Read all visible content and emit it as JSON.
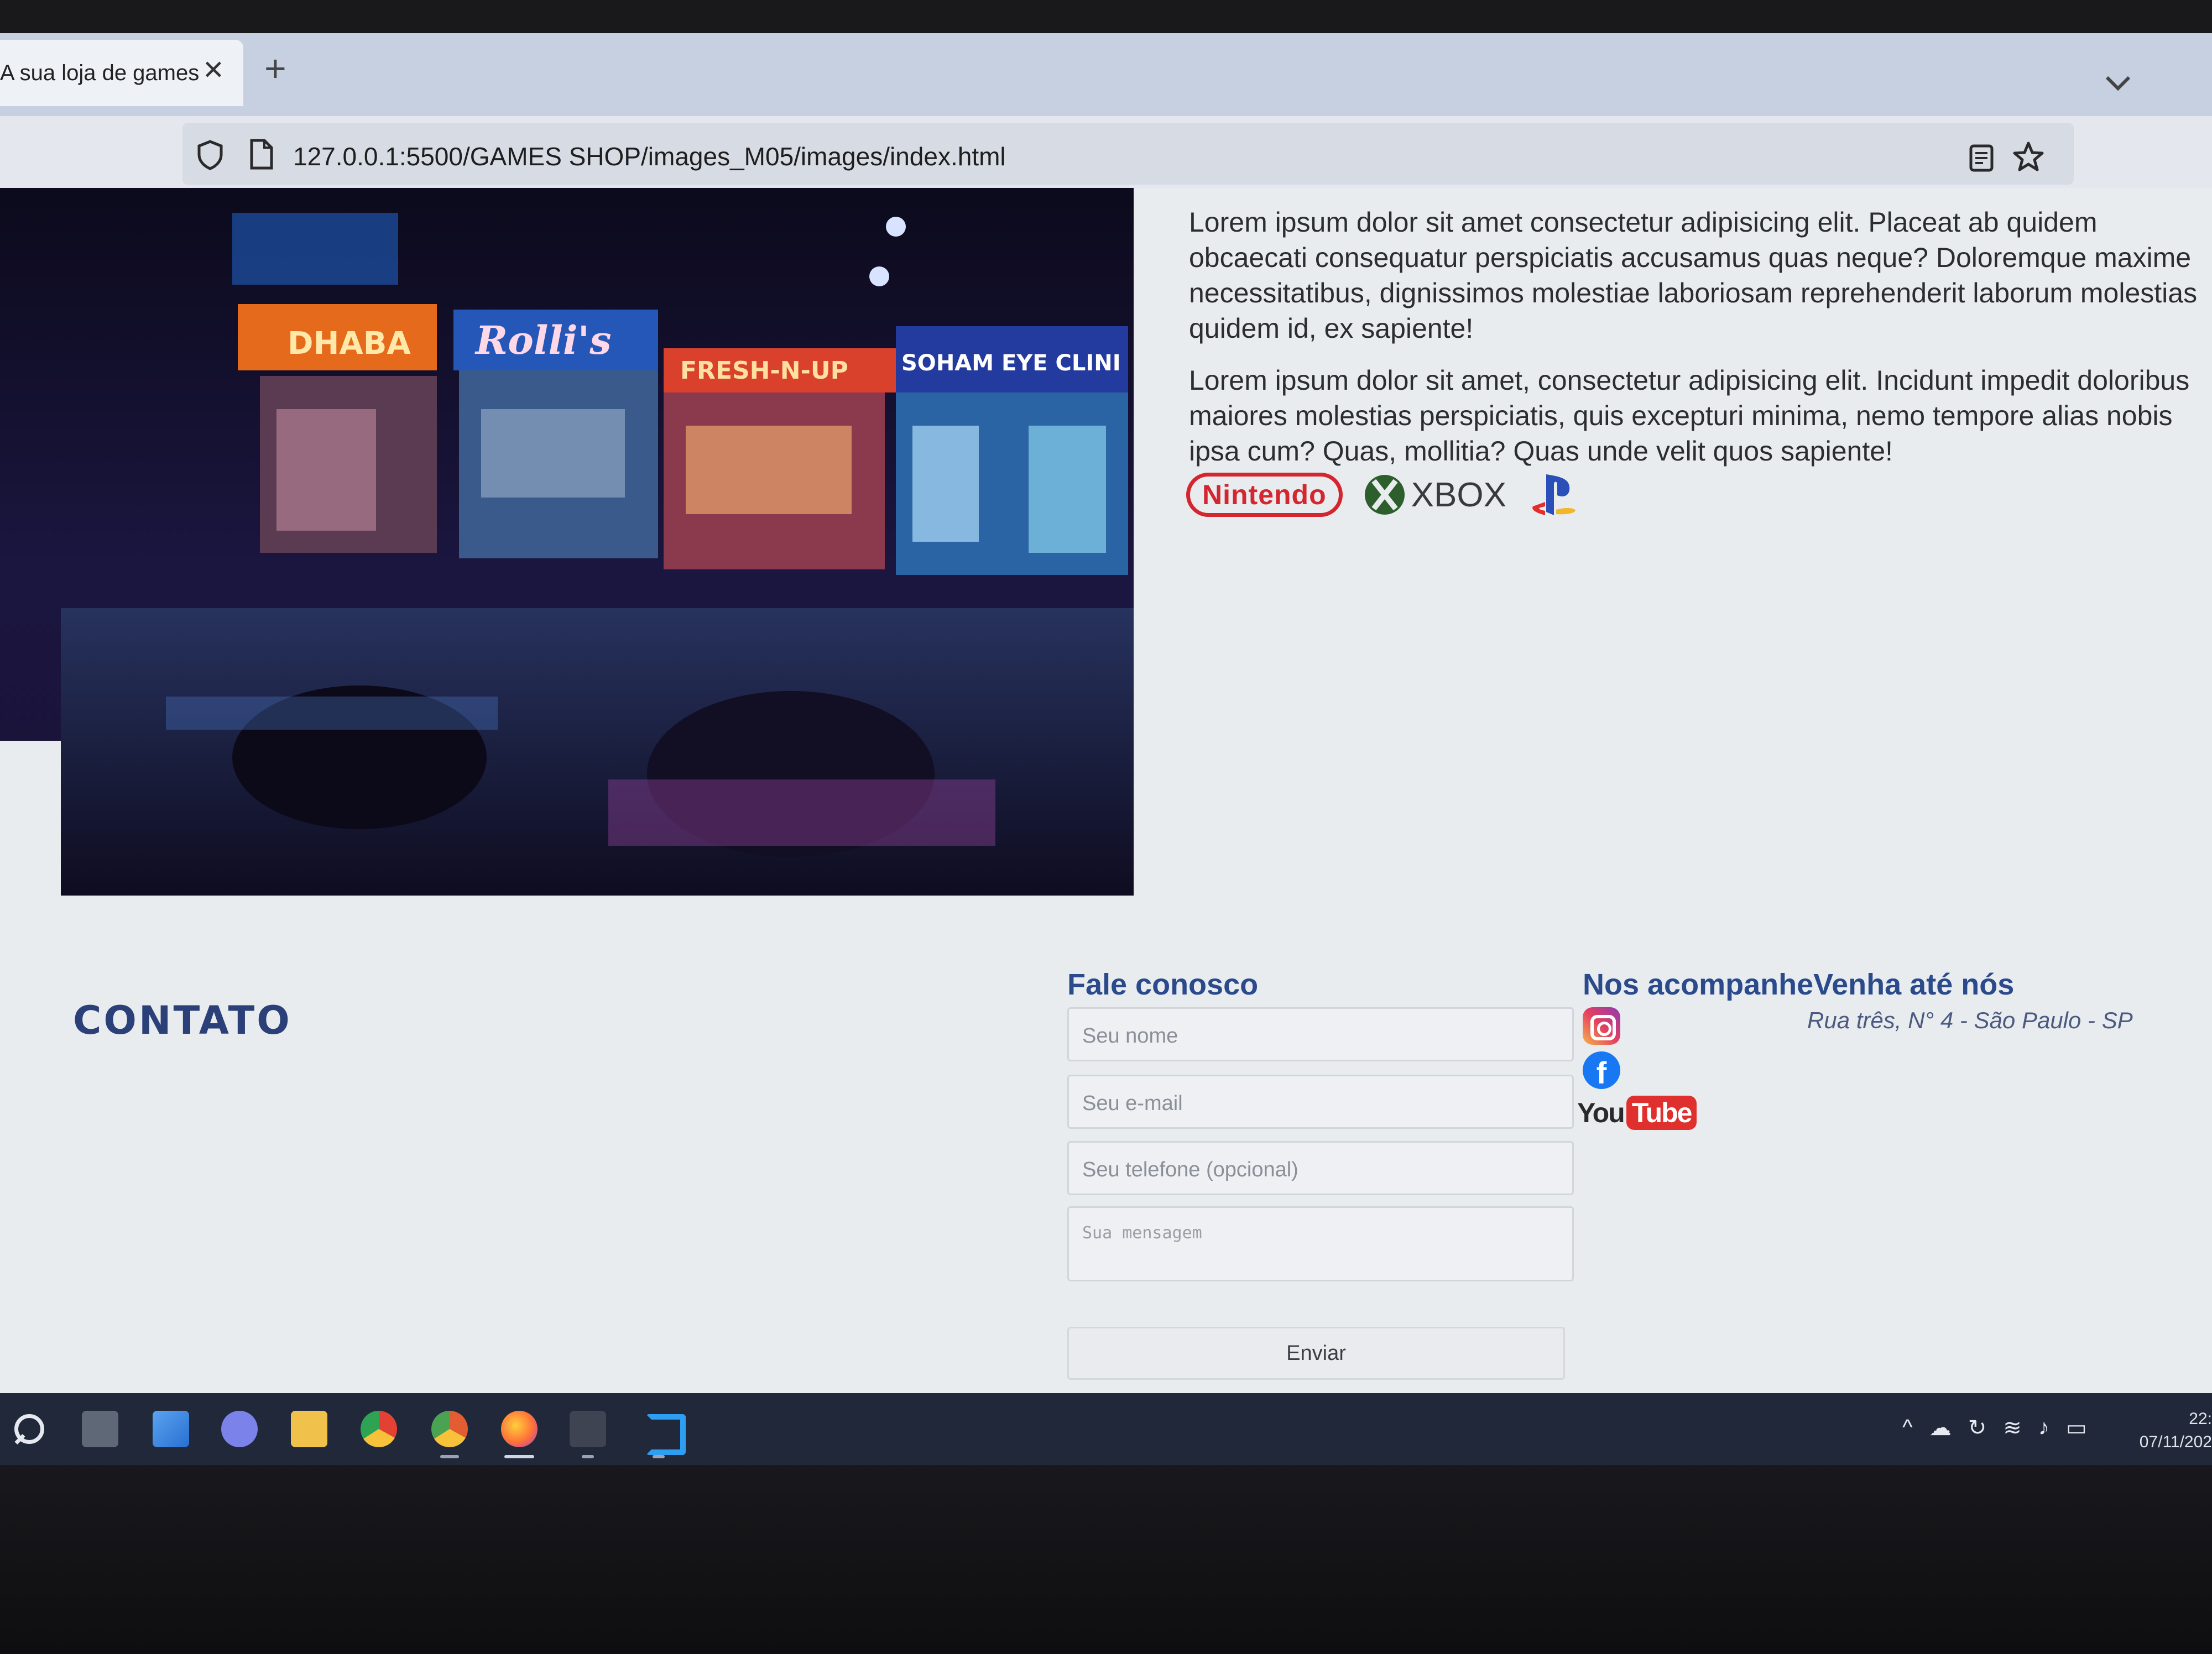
{
  "browser": {
    "tab_title": "A sua loja de games",
    "tab_close": "✕",
    "new_tab": "+",
    "url": "127.0.0.1:5500/GAMES SHOP/images_M05/images/index.html"
  },
  "intro": {
    "paragraph_1": "Lorem ipsum dolor sit amet consectetur adipisicing elit. Placeat ab quidem obcaecati consequatur perspiciatis accusamus quas neque? Doloremque maxime necessitatibus, dignissimos molestiae laboriosam reprehenderit laborum molestias quidem id, ex sapiente!",
    "paragraph_2": "Lorem ipsum dolor sit amet, consectetur adipisicing elit. Incidunt impedit doloribus maiores molestias perspiciatis, quis excepturi minima, nemo tempore alias nobis ipsa cum? Quas, mollitia? Quas unde velit quos sapiente!"
  },
  "brands": {
    "nintendo": "Nintendo",
    "xbox": "XBOX"
  },
  "hero_signs": {
    "sign_1": "DHABA",
    "sign_2": "Rolli's",
    "sign_3": "FRESH-N-UP",
    "sign_4": "SOHAM EYE CLINI"
  },
  "contact": {
    "section_title": "CONTATO",
    "form_title": "Fale conosco",
    "name_placeholder": "Seu nome",
    "email_placeholder": "Seu e-mail",
    "phone_placeholder": "Seu telefone (opcional)",
    "message_placeholder": "Sua mensagem",
    "submit_label": "Enviar"
  },
  "social": {
    "title": "Nos acompanheVenha até nós",
    "address": "Rua três, N° 4 - São Paulo - SP",
    "youtube_you": "You",
    "youtube_tube": "Tube"
  },
  "taskbar": {
    "clock_time": "22:",
    "clock_date": "07/11/202"
  },
  "colors": {
    "heading_blue": "#2b4a8c",
    "contato_blue": "#2b3f78",
    "nintendo_red": "#d3262f"
  }
}
